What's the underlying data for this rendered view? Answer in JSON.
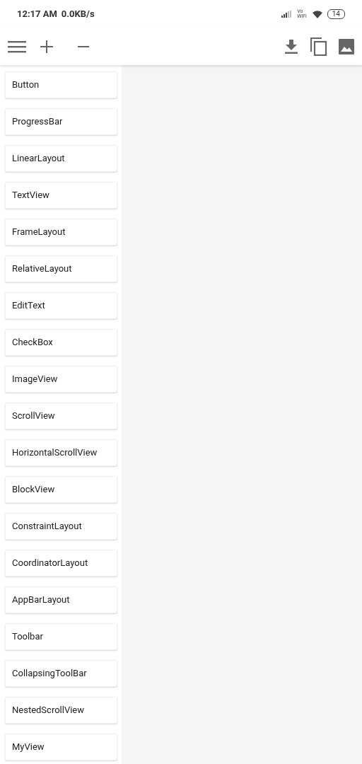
{
  "status_bar": {
    "time": "12:17 AM",
    "speed": "0.0KB/s",
    "network_label": "Vo\nWiFi",
    "battery": "14"
  },
  "palette": [
    "Button",
    "ProgressBar",
    "LinearLayout",
    "TextView",
    "FrameLayout",
    "RelativeLayout",
    "EditText",
    "CheckBox",
    "ImageView",
    "ScrollView",
    "HorizontalScrollView",
    "BlockView",
    "ConstraintLayout",
    "CoordinatorLayout",
    "AppBarLayout",
    "Toolbar",
    "CollapsingToolBar",
    "NestedScrollView",
    "MyView"
  ]
}
